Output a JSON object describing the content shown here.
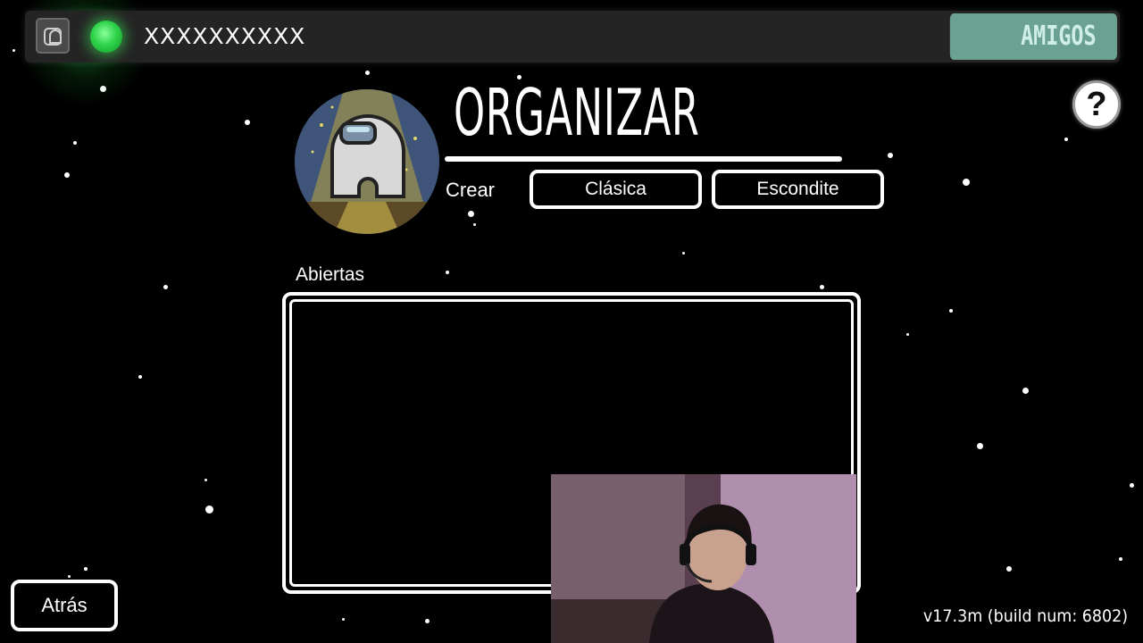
{
  "topbar": {
    "player_name": "XXXXXXXXXX",
    "friends_label": "AMIGOS",
    "status_color": "#2fd34a",
    "friends_color": "#6aa193"
  },
  "help": {
    "label": "?"
  },
  "host": {
    "title": "ORGANIZAR",
    "create_label": "Crear",
    "modes": [
      "Clásica",
      "Escondite"
    ]
  },
  "games": {
    "open_label": "Abiertas"
  },
  "footer": {
    "back_label": "Atrás",
    "version": "v17.3m (build num: 6802)"
  },
  "icons": {
    "account": "account-icon",
    "help": "help-icon",
    "avatar": "crewmate-avatar"
  }
}
